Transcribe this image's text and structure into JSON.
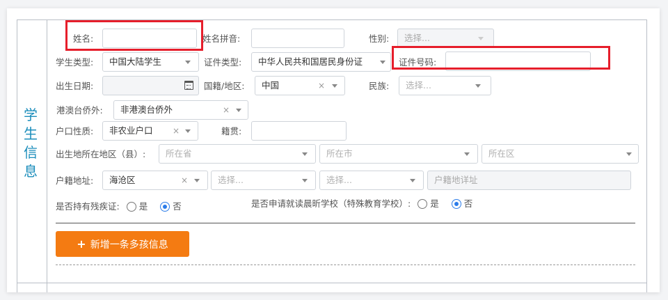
{
  "section": {
    "title": [
      "学",
      "生",
      "信",
      "息"
    ]
  },
  "fields": {
    "name": {
      "label": "姓名:",
      "value": ""
    },
    "pinyin": {
      "label": "姓名拼音:",
      "value": ""
    },
    "gender": {
      "label": "性别:",
      "placeholder": "选择..."
    },
    "student_type": {
      "label": "学生类型:",
      "value": "中国大陆学生"
    },
    "id_type": {
      "label": "证件类型:",
      "value": "中华人民共和国居民身份证"
    },
    "id_number": {
      "label": "证件号码:",
      "value": ""
    },
    "birth_date": {
      "label": "出生日期:",
      "value": ""
    },
    "nationality": {
      "label": "国籍/地区:",
      "value": "中国"
    },
    "ethnicity": {
      "label": "民族:",
      "placeholder": "选择..."
    },
    "overseas": {
      "label": "港澳台侨外:",
      "value": "非港澳台侨外"
    },
    "hukou_type": {
      "label": "户口性质:",
      "value": "非农业户口"
    },
    "native_place": {
      "label": "籍贯:",
      "value": ""
    },
    "birthplace": {
      "label": "出生地所在地区（县）:",
      "province": "所在省",
      "city": "所在市",
      "district": "所在区"
    },
    "hukou_address": {
      "label": "户籍地址:",
      "value": "海沧区",
      "select2": "选择...",
      "select3": "选择...",
      "detail": "户籍地详址"
    },
    "disability": {
      "label": "是否持有残疾证:",
      "yes": "是",
      "no": "否",
      "selected": "no"
    },
    "special_school": {
      "label": "是否申请就读晨昕学校（特殊教育学校）:",
      "yes": "是",
      "no": "否",
      "selected": "no"
    }
  },
  "actions": {
    "add_child": "新增一条多孩信息",
    "add_icon": "+"
  },
  "colors": {
    "accent": "#f47b12",
    "highlight": "#e61e2b",
    "title": "#1b8dbb",
    "radio": "#2b7ce9"
  }
}
